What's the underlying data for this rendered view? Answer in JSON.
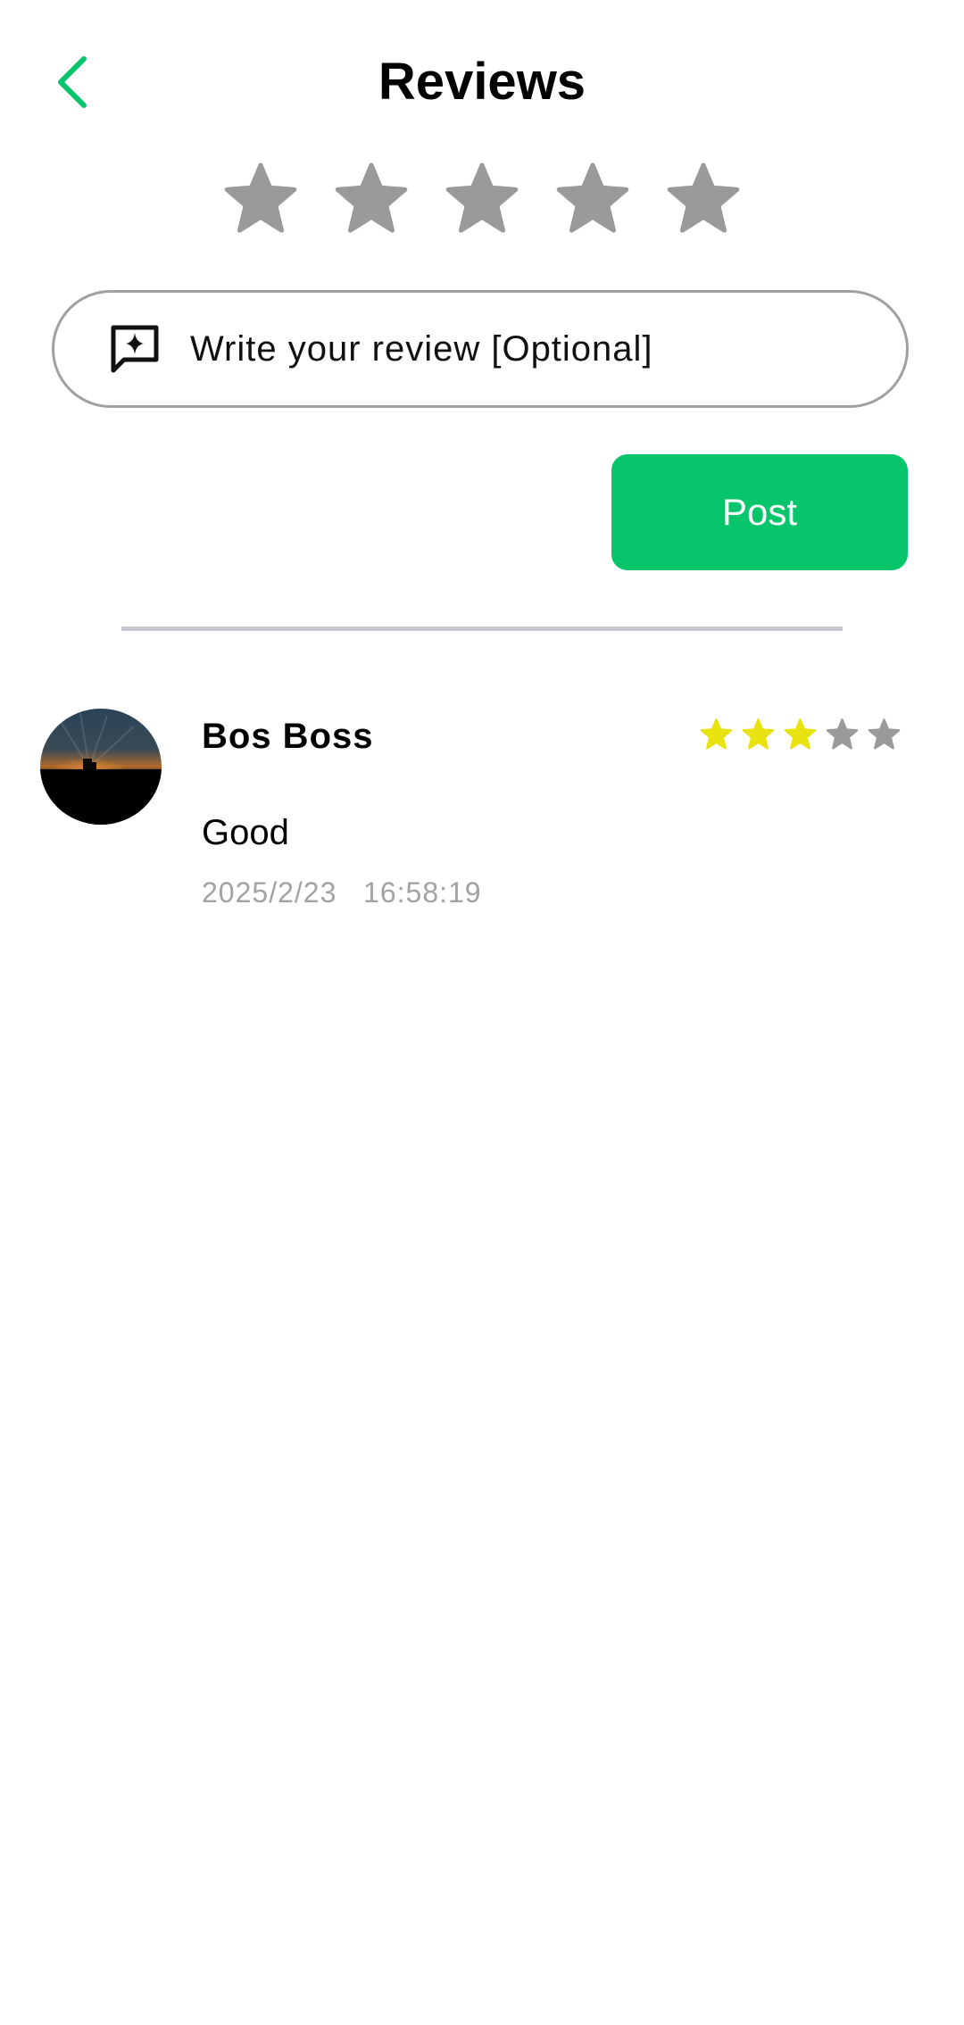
{
  "header": {
    "title": "Reviews",
    "back_icon": "chevron-left-icon"
  },
  "colors": {
    "accent": "#06c56b",
    "star_empty": "#9a9a9a",
    "star_filled": "#e8e20e",
    "divider": "#c8c8d0",
    "muted_text": "#a3a3a3"
  },
  "rating_input": {
    "max": 5,
    "selected": 0
  },
  "review_input": {
    "placeholder": "Write your review [Optional]",
    "value": "",
    "icon": "chat-sparkle-icon"
  },
  "post_button": {
    "label": "Post"
  },
  "reviews": [
    {
      "name": "Bos Boss",
      "rating": 3,
      "max_rating": 5,
      "text": "Good",
      "timestamp": "2025/2/23   16:58:19",
      "avatar": "sunset-silhouette-avatar"
    }
  ]
}
